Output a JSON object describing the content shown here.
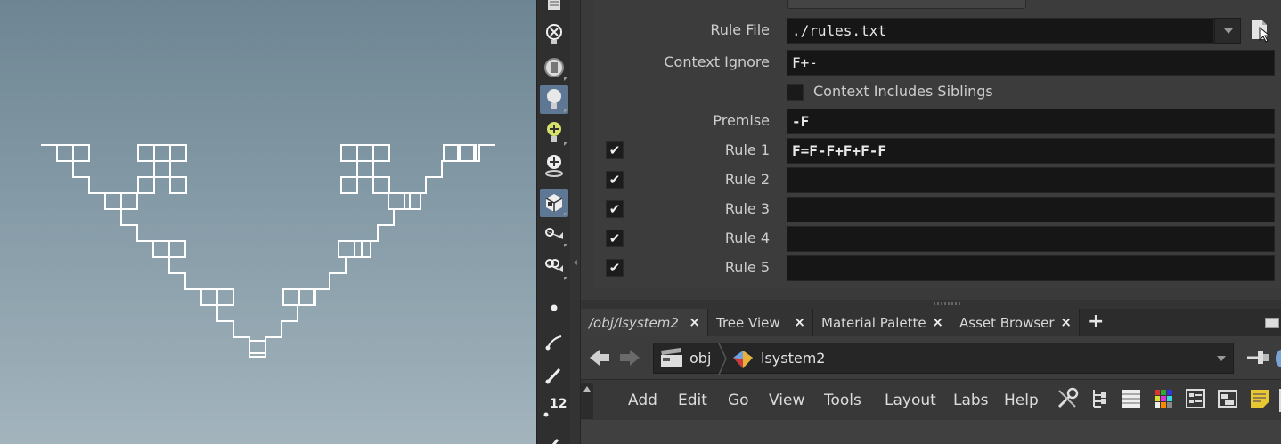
{
  "parameters": {
    "rule_file": {
      "label": "Rule File",
      "value": "./rules.txt"
    },
    "context_ignore": {
      "label": "Context Ignore",
      "value": "F+-"
    },
    "context_siblings": {
      "label": "Context Includes Siblings",
      "checked": false
    },
    "premise": {
      "label": "Premise",
      "value": "-F"
    },
    "rules": [
      {
        "label": "Rule 1",
        "value": "F=F-F+F+F-F",
        "enabled": true
      },
      {
        "label": "Rule 2",
        "value": "",
        "enabled": true
      },
      {
        "label": "Rule 3",
        "value": "",
        "enabled": true
      },
      {
        "label": "Rule 4",
        "value": "",
        "enabled": true
      },
      {
        "label": "Rule 5",
        "value": "",
        "enabled": true
      }
    ]
  },
  "tabs": [
    {
      "label": "/obj/lsystem2",
      "active": true,
      "close": "×"
    },
    {
      "label": "Tree View",
      "active": false,
      "close": "×"
    },
    {
      "label": "Material Palette",
      "active": false,
      "close": "×"
    },
    {
      "label": "Asset Browser",
      "active": false,
      "close": "×"
    }
  ],
  "tab_add": "+",
  "path": {
    "level1": "obj",
    "level2": "lsystem2"
  },
  "network_menu": [
    "Add",
    "Edit",
    "Go",
    "View",
    "Tools",
    "Layout",
    "Labs",
    "Help"
  ],
  "shelf_badge": "12",
  "check_glyph": "✔",
  "colors": {
    "selection": "#5d7794",
    "field_bg": "#161616",
    "panel_bg": "#3c3c3c"
  },
  "shelf_icons": [
    "display-icon",
    "light-x-icon",
    "ambient-light-icon",
    "point-light-icon",
    "spot-light-icon",
    "env-light-icon",
    "geometry-icon",
    "camera-icon",
    "stereo-camera-icon",
    "point-icon",
    "curve-icon",
    "pen-icon",
    "number-icon",
    "paint-icon"
  ]
}
